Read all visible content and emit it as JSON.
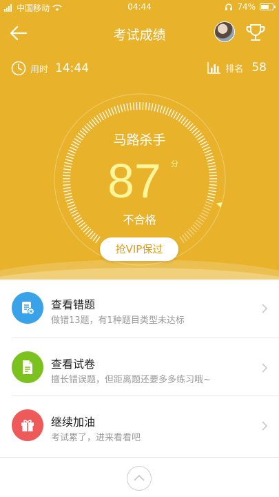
{
  "status_bar": {
    "carrier": "中国移动",
    "time": "04:44",
    "battery": "74%",
    "battery_level": 0.74
  },
  "nav": {
    "title": "考试成绩"
  },
  "stats": {
    "time_label": "用时",
    "time_value": "14:44",
    "rank_label": "排名",
    "rank_value": "58"
  },
  "result": {
    "name": "马路杀手",
    "score": "87",
    "unit": "分",
    "verdict": "不合格",
    "score_fraction": 0.87
  },
  "vip_button": "抢VIP保过",
  "actions": [
    {
      "title": "查看错题",
      "subtitle": "做错13题，有1种题目类型未达标",
      "color": "#3aa2e8",
      "icon": "wrong-questions-icon"
    },
    {
      "title": "查看试卷",
      "subtitle": "擅长错误题，但距离题还要多多练习哦~",
      "color": "#7cc21f",
      "icon": "exam-paper-icon"
    },
    {
      "title": "继续加油",
      "subtitle": "考试累了，进来看看吧",
      "color": "#ee5a5a",
      "icon": "gift-icon"
    }
  ],
  "colors": {
    "hero": "#e8b22a",
    "score": "#fff59a",
    "accent": "#d79e18"
  }
}
